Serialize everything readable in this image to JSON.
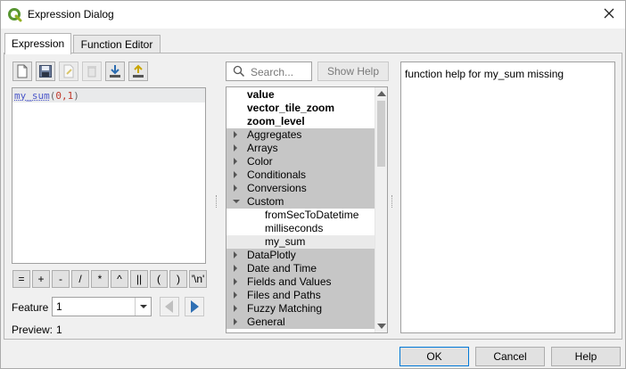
{
  "window": {
    "title": "Expression Dialog"
  },
  "tabs": [
    {
      "label": "Expression",
      "active": true
    },
    {
      "label": "Function Editor",
      "active": false
    }
  ],
  "toolbar": {
    "icons": [
      "new-file-icon",
      "save-icon",
      "edit-icon",
      "delete-icon",
      "import-icon",
      "export-icon"
    ]
  },
  "editor": {
    "fn_name": "my_sum",
    "open": "(",
    "args": "0,1",
    "close": ")"
  },
  "operators": [
    "=",
    "+",
    "-",
    "/",
    "*",
    "^",
    "||",
    "(",
    ")",
    "'\\n'"
  ],
  "feature": {
    "label": "Feature",
    "value": "1"
  },
  "preview": {
    "label": "Preview:",
    "value": "1"
  },
  "search": {
    "placeholder": "Search..."
  },
  "show_help_label": "Show Help",
  "tree": {
    "items": [
      {
        "label": "value",
        "kind": "bold"
      },
      {
        "label": "vector_tile_zoom",
        "kind": "bold"
      },
      {
        "label": "zoom_level",
        "kind": "bold"
      },
      {
        "label": "Aggregates",
        "kind": "group",
        "expanded": false
      },
      {
        "label": "Arrays",
        "kind": "group",
        "expanded": false
      },
      {
        "label": "Color",
        "kind": "group",
        "expanded": false
      },
      {
        "label": "Conditionals",
        "kind": "group",
        "expanded": false
      },
      {
        "label": "Conversions",
        "kind": "group",
        "expanded": false
      },
      {
        "label": "Custom",
        "kind": "group",
        "expanded": true
      },
      {
        "label": "fromSecToDatetime",
        "kind": "child"
      },
      {
        "label": "milliseconds",
        "kind": "child"
      },
      {
        "label": "my_sum",
        "kind": "child",
        "selected": true
      },
      {
        "label": "DataPlotly",
        "kind": "group",
        "expanded": false
      },
      {
        "label": "Date and Time",
        "kind": "group",
        "expanded": false
      },
      {
        "label": "Fields and Values",
        "kind": "group",
        "expanded": false
      },
      {
        "label": "Files and Paths",
        "kind": "group",
        "expanded": false
      },
      {
        "label": "Fuzzy Matching",
        "kind": "group",
        "expanded": false
      },
      {
        "label": "General",
        "kind": "group",
        "expanded": false
      }
    ]
  },
  "help": {
    "text": "function help for my_sum missing"
  },
  "buttons": {
    "ok": "OK",
    "cancel": "Cancel",
    "help": "Help"
  },
  "colors": {
    "accent": "#0078d7",
    "function_name": "#4a56c9",
    "args": "#c0392b",
    "group_bg": "#c6c6c6"
  }
}
